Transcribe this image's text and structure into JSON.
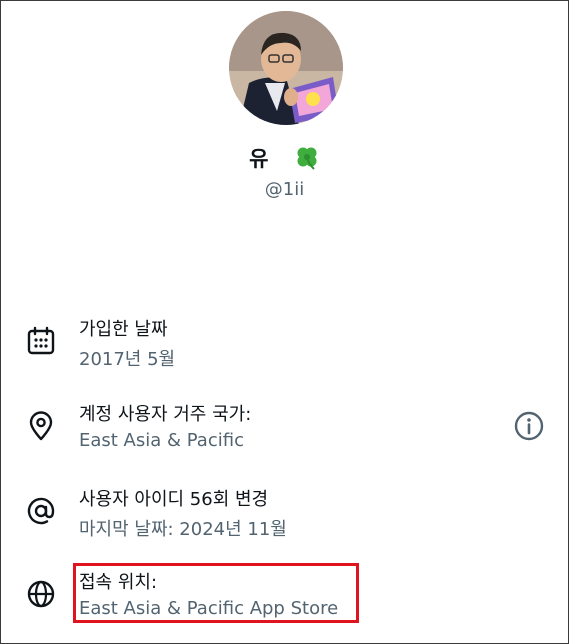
{
  "profile": {
    "display_name": "유",
    "handle": "@1ii"
  },
  "details": [
    {
      "title": "가입한 날짜",
      "subtitle": "2017년 5월",
      "icon": "calendar-icon"
    },
    {
      "title": "계정 사용자 거주 국가:",
      "subtitle": "East Asia & Pacific",
      "icon": "location-pin-icon"
    },
    {
      "title": "사용자 아이디 56회 변경",
      "subtitle": "마지막 날짜: 2024년 11월",
      "icon": "at-sign-icon"
    },
    {
      "title": "접속 위치:",
      "subtitle": "East Asia & Pacific App Store",
      "icon": "globe-icon"
    }
  ],
  "colors": {
    "text_primary": "#0f1419",
    "text_secondary": "#536471",
    "highlight": "#e0141e"
  }
}
